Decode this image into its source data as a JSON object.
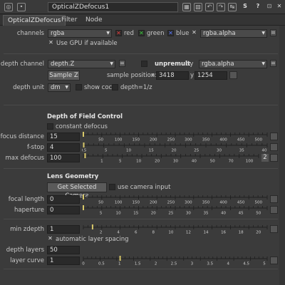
{
  "titlebar": {
    "title": "OpticalZDefocus1",
    "left_icons": [
      "panel-dock-icon",
      "center-node-icon"
    ],
    "right_icons": [
      {
        "name": "input-color-icon",
        "glyph": "▦"
      },
      {
        "name": "checkerboard-icon",
        "glyph": "▧"
      },
      {
        "name": "undo-icon",
        "glyph": "↶"
      },
      {
        "name": "redo-icon",
        "glyph": "↷"
      },
      {
        "name": "script-icon",
        "glyph": "S"
      },
      {
        "name": "help-icon",
        "glyph": "?"
      },
      {
        "name": "float-icon",
        "glyph": "⊡"
      },
      {
        "name": "close-icon",
        "glyph": "✕"
      }
    ]
  },
  "tabs": [
    "OpticalZDefocus",
    "Filter",
    "Node"
  ],
  "colors": {
    "red": "#e03c3c",
    "green": "#3ccc3c",
    "blue": "#5a78ff",
    "check": "#dddddd",
    "accent_slider": "#d8c86a"
  },
  "channels": {
    "label": "channels",
    "value": "rgba",
    "red": "red",
    "green": "green",
    "blue": "blue",
    "alpha_value": "rgba.alpha",
    "gpu_label": "Use GPU if available"
  },
  "depth": {
    "channel_label": "depth channel",
    "channel_value": "depth.Z",
    "unpremult_label": "unpremult",
    "by_label": "by",
    "unpremult_value": "rgba.alpha",
    "sample_button": "Sample Z",
    "sample_pos_label": "sample position:",
    "x_label": "x",
    "x_value": "3418",
    "y_label": "y",
    "y_value": "1254",
    "unit_label": "depth unit",
    "unit_value": "dm",
    "show_coc": "show coc",
    "depth_inv": "depth=1/z"
  },
  "dof": {
    "heading": "Depth of Field Control",
    "constant_defocus": "constant defocus",
    "focus_label": "focus distance",
    "focus_value": "15",
    "focus_ticks": [
      "50",
      "100",
      "150",
      "200",
      "250",
      "300",
      "350",
      "400",
      "450",
      "500"
    ],
    "fstop_label": "f-stop",
    "fstop_value": "4",
    "fstop_ticks": [
      "0.5",
      "5",
      "10",
      "15",
      "20",
      "25",
      "30",
      "35",
      "40"
    ],
    "maxdefocus_label": "max defocus",
    "maxdefocus_value": "100",
    "maxdefocus_ticks": [
      "1",
      "5",
      "10",
      "20",
      "30",
      "40",
      "50",
      "70",
      "100"
    ],
    "maxdefocus_badge": "2"
  },
  "lens": {
    "heading": "Lens Geometry",
    "get_camera_button": "Get Selected Camera",
    "use_camera_input": "use camera input",
    "focal_label": "focal length",
    "focal_value": "0",
    "focal_ticks": [
      "50",
      "100",
      "150",
      "200",
      "250",
      "300",
      "350",
      "400",
      "450",
      "500"
    ],
    "haperture_label": "haperture",
    "haperture_value": "0",
    "haperture_ticks": [
      "5",
      "10",
      "15",
      "20",
      "25",
      "30",
      "35",
      "40",
      "45",
      "50"
    ]
  },
  "layers": {
    "minz_label": "min zdepth",
    "minz_value": "1",
    "minz_ticks": [
      "2",
      "4",
      "6",
      "8",
      "10",
      "12",
      "14",
      "16",
      "18",
      "20"
    ],
    "auto_spacing": "automatic layer spacing",
    "depth_layers_label": "depth layers",
    "depth_layers_value": "50",
    "layer_curve_label": "layer curve",
    "layer_curve_value": "1",
    "curve_ticks": [
      "0",
      "0.5",
      "1",
      "1.5",
      "2",
      "2.5",
      "3",
      "3.5",
      "4",
      "4.5",
      "5"
    ]
  }
}
